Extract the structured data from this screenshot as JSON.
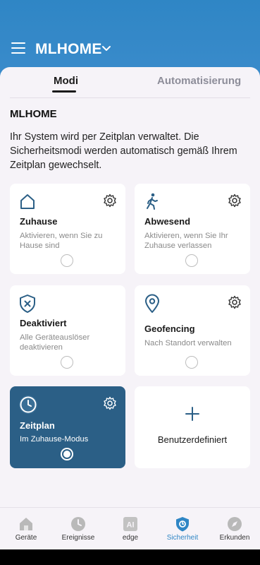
{
  "header": {
    "title": "MLHOME",
    "menu_icon": "hamburger-menu-icon",
    "dropdown_icon": "chevron-down-icon"
  },
  "tabs": [
    {
      "label": "Modi",
      "active": true
    },
    {
      "label": "Automatisierung",
      "active": false
    }
  ],
  "section": {
    "title": "MLHOME",
    "description": "Ihr System wird per Zeitplan verwaltet. Die Sicherheitsmodi werden automatisch gemäß Ihrem Zeitplan gewechselt."
  },
  "modes": [
    {
      "title": "Zuhause",
      "description": "Aktivieren, wenn Sie zu Hause sind",
      "icon": "house-icon",
      "selected": false,
      "has_settings": true
    },
    {
      "title": "Abwesend",
      "description": "Aktivieren, wenn Sie Ihr Zuhause verlassen",
      "icon": "walking-person-icon",
      "selected": false,
      "has_settings": true
    },
    {
      "title": "Deaktiviert",
      "description": "Alle Geräteauslöser deaktivieren",
      "icon": "shield-x-icon",
      "selected": false,
      "has_settings": false
    },
    {
      "title": "Geofencing",
      "description": "Nach Standort verwalten",
      "icon": "location-pin-icon",
      "selected": false,
      "has_settings": true
    },
    {
      "title": "Zeitplan",
      "description": "Im Zuhause-Modus",
      "icon": "clock-icon",
      "selected": true,
      "has_settings": true
    }
  ],
  "custom_mode": {
    "label": "Benutzerdefiniert",
    "icon": "plus-icon"
  },
  "bottom_nav": [
    {
      "label": "Geräte",
      "icon": "home-icon",
      "active": false
    },
    {
      "label": "Ereignisse",
      "icon": "clock-icon",
      "active": false
    },
    {
      "label": "edge",
      "icon": "ai-icon",
      "active": false
    },
    {
      "label": "Sicherheit",
      "icon": "shield-icon",
      "active": true
    },
    {
      "label": "Erkunden",
      "icon": "compass-icon",
      "active": false
    }
  ],
  "colors": {
    "header_blue": "#2f86c5",
    "selected_card": "#2b5f86",
    "icon_blue": "#2b5f86",
    "background": "#f6f3f8"
  }
}
